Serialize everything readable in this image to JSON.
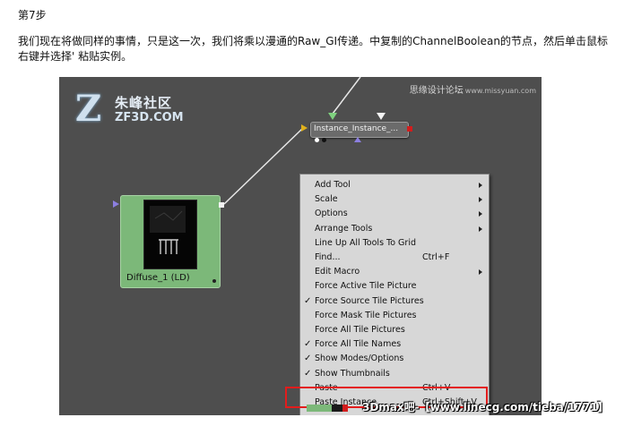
{
  "step_title": "第7步",
  "instruction": "我们现在将做同样的事情，只是这一次，我们将乘以漫通的Raw_GI传递。中复制的ChannelBoolean的节点，然后单击鼠标右键并选择' 粘贴实例。",
  "logo": {
    "mark": "Z",
    "name_cn": "朱峰社区",
    "name_en": "ZF3D.COM"
  },
  "watermark_top": {
    "main": "思缘设计论坛",
    "sub": "www.missyuan.com"
  },
  "nodes": {
    "instance": {
      "label": "Instance_Instance_..."
    },
    "diffuse": {
      "label": "Diffuse_1  (LD)"
    }
  },
  "context_menu": {
    "items": [
      {
        "label": "Add Tool",
        "shortcut": "",
        "checked": false,
        "submenu": true
      },
      {
        "label": "Scale",
        "shortcut": "",
        "checked": false,
        "submenu": true
      },
      {
        "label": "Options",
        "shortcut": "",
        "checked": false,
        "submenu": true
      },
      {
        "label": "Arrange Tools",
        "shortcut": "",
        "checked": false,
        "submenu": true
      },
      {
        "label": "Line Up All Tools To Grid",
        "shortcut": "",
        "checked": false,
        "submenu": false
      },
      {
        "label": "Find...",
        "shortcut": "Ctrl+F",
        "checked": false,
        "submenu": false
      },
      {
        "label": "Edit Macro",
        "shortcut": "",
        "checked": false,
        "submenu": true
      },
      {
        "label": "Force Active Tile Picture",
        "shortcut": "",
        "checked": false,
        "submenu": false
      },
      {
        "label": "Force Source Tile Pictures",
        "shortcut": "",
        "checked": true,
        "submenu": false
      },
      {
        "label": "Force Mask Tile Pictures",
        "shortcut": "",
        "checked": false,
        "submenu": false
      },
      {
        "label": "Force All Tile Pictures",
        "shortcut": "",
        "checked": false,
        "submenu": false
      },
      {
        "label": "Force All Tile Names",
        "shortcut": "",
        "checked": true,
        "submenu": false
      },
      {
        "label": "Show Modes/Options",
        "shortcut": "",
        "checked": true,
        "submenu": false
      },
      {
        "label": "Show Thumbnails",
        "shortcut": "",
        "checked": true,
        "submenu": false
      },
      {
        "label": "Paste",
        "shortcut": "Ctrl+V",
        "checked": false,
        "submenu": false
      },
      {
        "label": "Paste Instance",
        "shortcut": "Ctrl+Shift+V",
        "checked": false,
        "submenu": false
      }
    ],
    "checkmark": "✓"
  },
  "watermark_bottom": "3Dmax吧-【www.linecg.com/tieba/1771】",
  "colors": {
    "canvas": "#4e4e4e",
    "menu_bg": "#d7d7d7",
    "node_green": "#7cb879",
    "highlight_red": "#e31c1c",
    "connector_yellow": "#e0b11c",
    "output_red": "#d21d1d",
    "input_purple": "#8c7fe0"
  }
}
